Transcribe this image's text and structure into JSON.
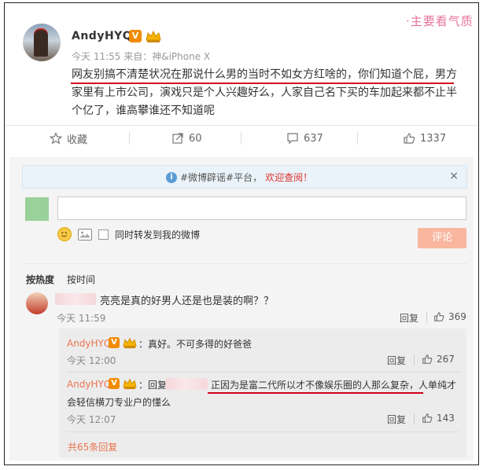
{
  "post": {
    "author": "AndyHYQ",
    "v_badge": "V",
    "meta": "今天 11:55 来自：神&iPhone X",
    "text_line1": "网友别搞不清楚状况在那说什么男的当时不如女方红啥的，你们知道个屁，男方",
    "text_line2": "家里有上市公司，演戏只是个人兴趣好么，人家自己名下买的车加起来都不止半",
    "text_line3": "个亿了，谁高攀谁还不知道呢",
    "watermark": "·主要看气质"
  },
  "actions": {
    "favorite_label": "收藏",
    "repost_count": "60",
    "comment_count": "637",
    "like_count": "1337"
  },
  "notice": {
    "prefix": "#微博辟谣#平台，",
    "link": "欢迎查阅！",
    "close": "×"
  },
  "composer": {
    "checkbox_label": "同时转发到我的微博",
    "submit_label": "评论"
  },
  "sort": {
    "by_hot": "按热度",
    "by_time": "按时间"
  },
  "comments": [
    {
      "text": "亮亮是真的好男人还是也是装的啊？？",
      "time": "今天 11:59",
      "reply_label": "回复",
      "likes": "369"
    }
  ],
  "sub_comments": [
    {
      "author": "AndyHYQ",
      "v_badge": "V",
      "text": "：真好。不可多得的好爸爸",
      "time": "今天 12:00",
      "reply_label": "回复",
      "likes": "267"
    },
    {
      "author": "AndyHYQ",
      "v_badge": "V",
      "text_prefix": "：回复",
      "text_main": "正因为是富二代所以才不像娱乐圈的人那么复杂，人单纯才",
      "text_line2": "会轻信横刀专业户的懂么",
      "time": "今天 12:07",
      "reply_label": "回复",
      "likes": "143"
    }
  ],
  "more_replies": "共65条回复",
  "colors": {
    "accent_orange": "#eb7350",
    "underline_red": "#d0021b",
    "submit_disabled": "#f9b7a0"
  }
}
